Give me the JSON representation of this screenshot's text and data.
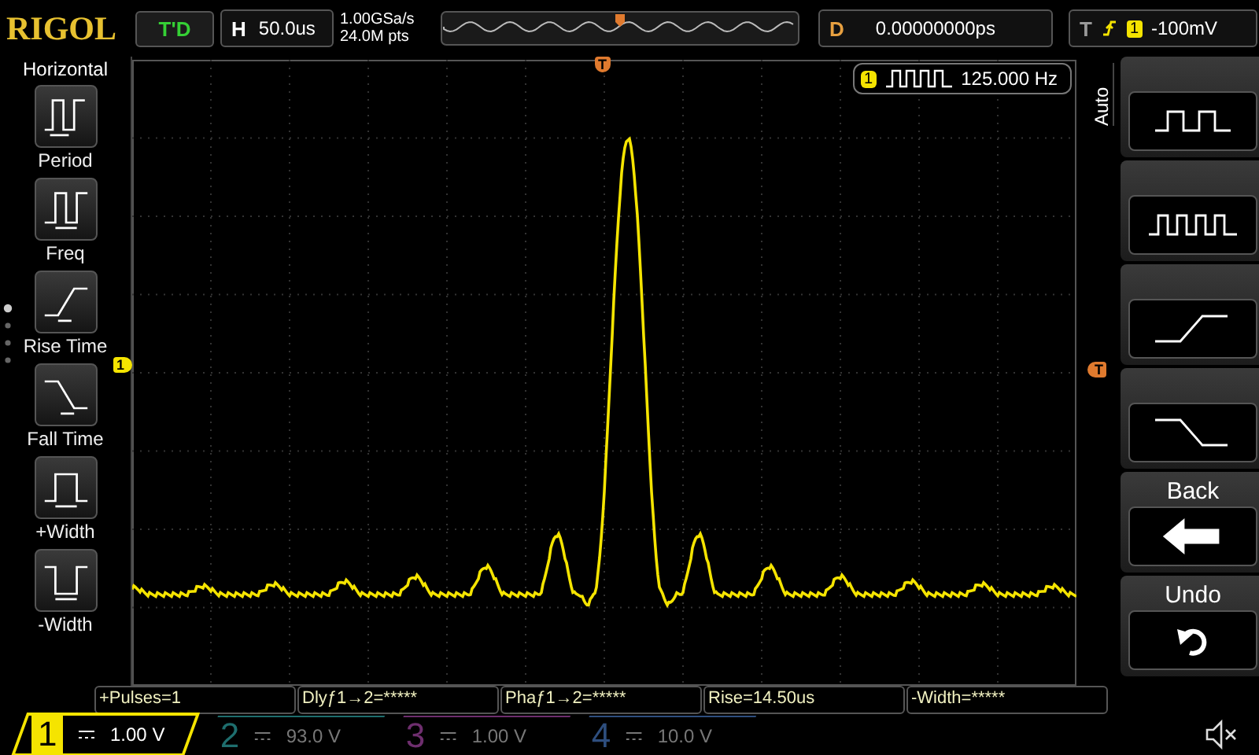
{
  "header": {
    "logo": "RIGOL",
    "run_status": "T'D",
    "timebase_label": "H",
    "timebase": "50.0us",
    "sample_rate": "1.00GSa/s",
    "memory_depth": "24.0M pts",
    "delay_label": "D",
    "delay": "0.00000000ps",
    "trigger_label": "T",
    "trigger_channel": "1",
    "trigger_level": "-100mV"
  },
  "left_menu": {
    "title": "Horizontal",
    "items": [
      {
        "label": "Period",
        "kind": "period"
      },
      {
        "label": "Freq",
        "kind": "freq"
      },
      {
        "label": "Rise Time",
        "kind": "rise"
      },
      {
        "label": "Fall Time",
        "kind": "fall"
      },
      {
        "label": "+Width",
        "kind": "pwidth"
      },
      {
        "label": "-Width",
        "kind": "nwidth"
      }
    ]
  },
  "plot": {
    "trigger_marker": "T",
    "level_marker": "T",
    "channel_marker": "1",
    "counter": {
      "channel": "1",
      "value": "125.000 Hz"
    }
  },
  "right_menu": {
    "title": "Auto",
    "items": [
      {
        "kind": "square"
      },
      {
        "kind": "pulses"
      },
      {
        "kind": "rise"
      },
      {
        "kind": "fall"
      },
      {
        "kind": "back",
        "label": "Back"
      },
      {
        "kind": "undo",
        "label": "Undo"
      }
    ]
  },
  "measurements": [
    "+Pulses=1",
    "Dlyƒ1→2=*****",
    "Phaƒ1→2=*****",
    "Rise=14.50us",
    "-Width=*****"
  ],
  "channels": [
    {
      "number": "1",
      "scale": "1.00 V",
      "selected": true,
      "color": "#f5e400"
    },
    {
      "number": "2",
      "scale": "93.0 V",
      "selected": false,
      "color": "#1e6e6e"
    },
    {
      "number": "3",
      "scale": "1.00 V",
      "selected": false,
      "color": "#6e2e6e"
    },
    {
      "number": "4",
      "scale": "10.0 V",
      "selected": false,
      "color": "#2e4e7e"
    }
  ]
}
